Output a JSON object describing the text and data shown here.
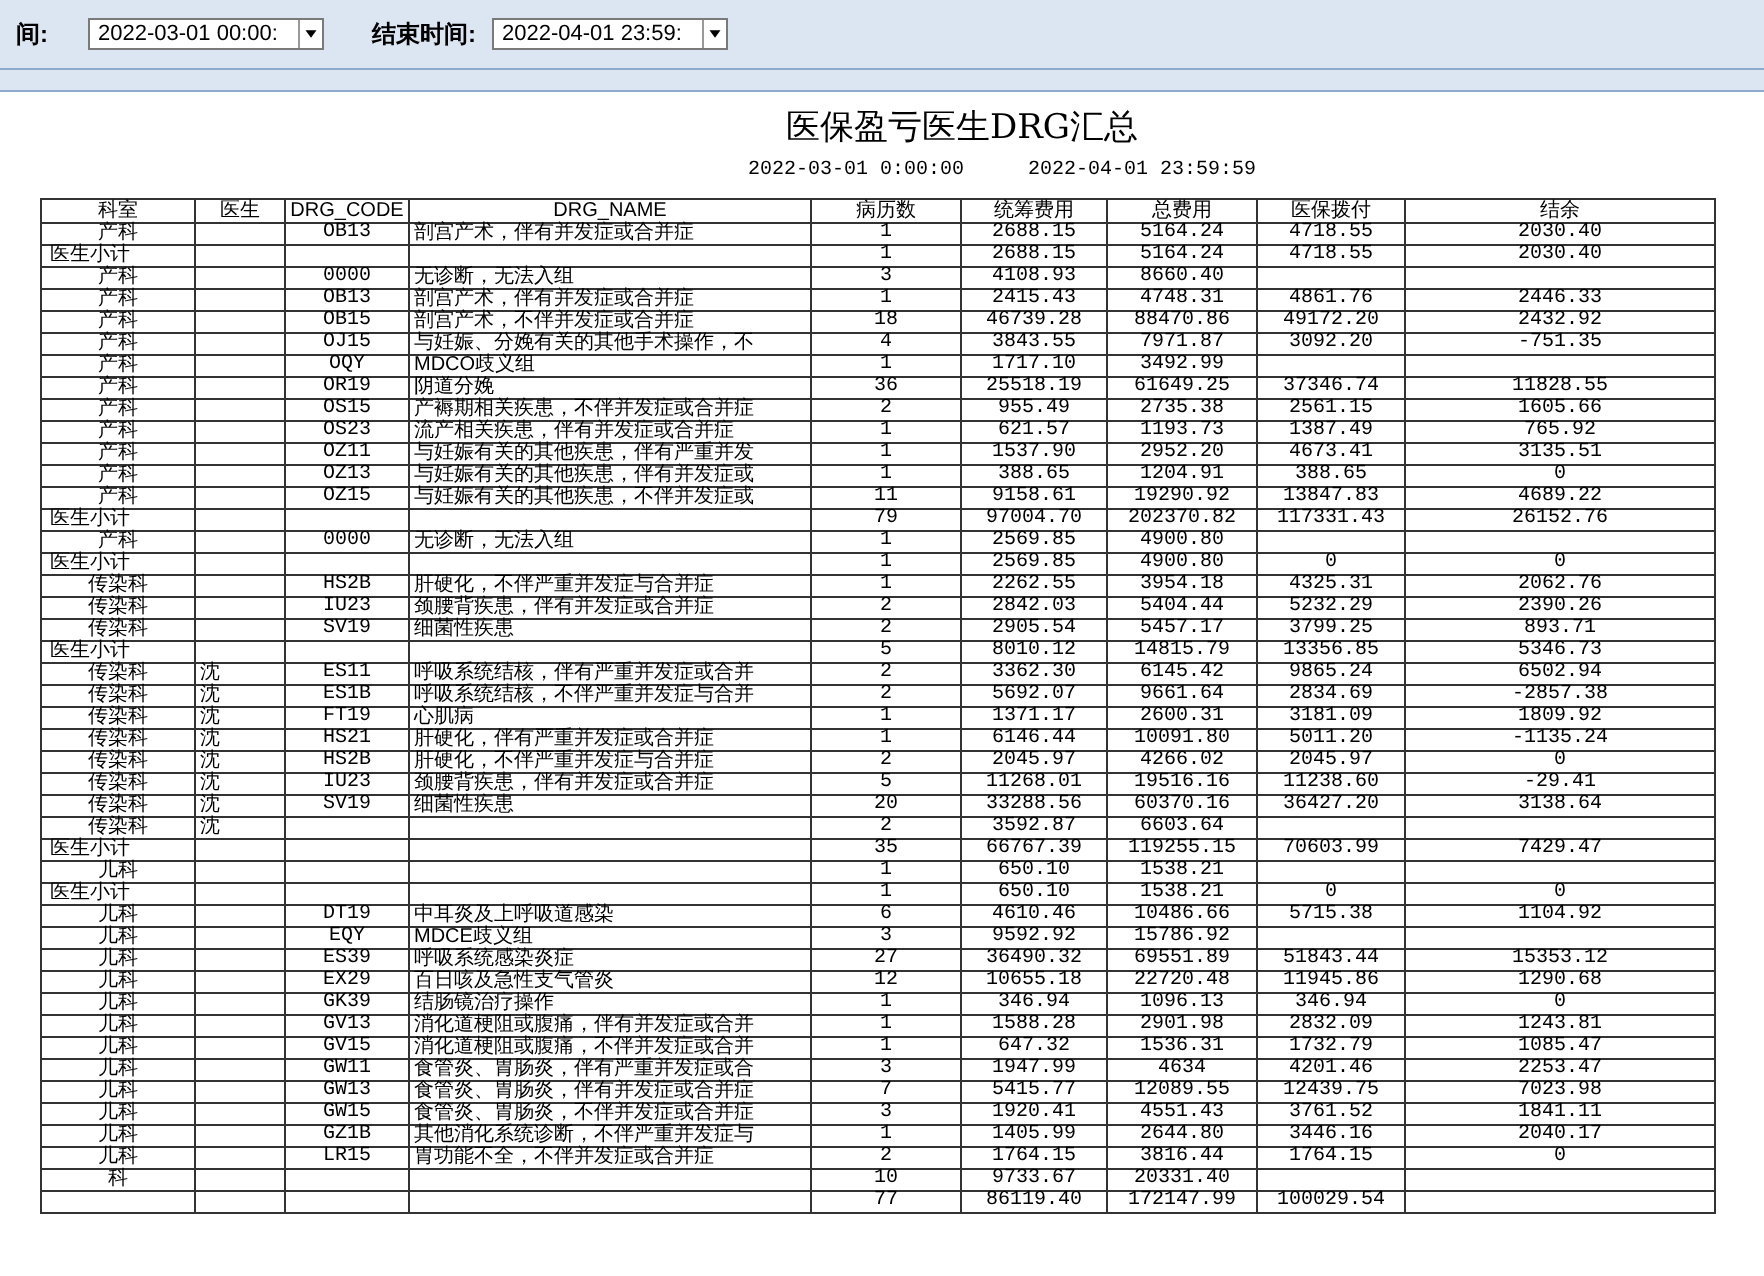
{
  "toolbar": {
    "start_label": "间:",
    "start_value": "2022-03-01 00:00:",
    "end_label": "结束时间:",
    "end_value": "2022-04-01 23:59:"
  },
  "report": {
    "title": "医保盈亏医生DRG汇总",
    "start": "2022-03-01  0:00:00",
    "end": "2022-04-01  23:59:59"
  },
  "columns": [
    "科室",
    "医生",
    "DRG_CODE",
    "DRG_NAME",
    "病历数",
    "统筹费用",
    "总费用",
    "医保拨付",
    "结余"
  ],
  "rows": [
    {
      "kind": "detail",
      "dept": "产科",
      "code": "OB13",
      "name": "剖宫产术，伴有并发症或合并症",
      "cases": "1",
      "pooled": "2688.15",
      "total": "5164.24",
      "paid": "4718.55",
      "balance": "2030.40"
    },
    {
      "kind": "subtotal",
      "dept": "医生小计",
      "cases": "1",
      "pooled": "2688.15",
      "total": "5164.24",
      "paid": "4718.55",
      "balance": "2030.40"
    },
    {
      "kind": "detail",
      "dept": "产科",
      "code": "0000",
      "name": "无诊断，无法入组",
      "cases": "3",
      "pooled": "4108.93",
      "total": "8660.40"
    },
    {
      "kind": "detail",
      "dept": "产科",
      "code": "OB13",
      "name": "剖宫产术，伴有并发症或合并症",
      "cases": "1",
      "pooled": "2415.43",
      "total": "4748.31",
      "paid": "4861.76",
      "balance": "2446.33"
    },
    {
      "kind": "detail",
      "dept": "产科",
      "code": "OB15",
      "name": "剖宫产术，不伴并发症或合并症",
      "cases": "18",
      "pooled": "46739.28",
      "total": "88470.86",
      "paid": "49172.20",
      "balance": "2432.92"
    },
    {
      "kind": "detail",
      "dept": "产科",
      "code": "OJ15",
      "name": "与妊娠、分娩有关的其他手术操作，不",
      "cases": "4",
      "pooled": "3843.55",
      "total": "7971.87",
      "paid": "3092.20",
      "balance": "-751.35"
    },
    {
      "kind": "detail",
      "dept": "产科",
      "code": "OQY",
      "name": "MDCO歧义组",
      "cases": "1",
      "pooled": "1717.10",
      "total": "3492.99"
    },
    {
      "kind": "detail",
      "dept": "产科",
      "code": "OR19",
      "name": "阴道分娩",
      "cases": "36",
      "pooled": "25518.19",
      "total": "61649.25",
      "paid": "37346.74",
      "balance": "11828.55"
    },
    {
      "kind": "detail",
      "dept": "产科",
      "code": "OS15",
      "name": "产褥期相关疾患，不伴并发症或合并症",
      "cases": "2",
      "pooled": "955.49",
      "total": "2735.38",
      "paid": "2561.15",
      "balance": "1605.66"
    },
    {
      "kind": "detail",
      "dept": "产科",
      "code": "OS23",
      "name": "流产相关疾患，伴有并发症或合并症",
      "cases": "1",
      "pooled": "621.57",
      "total": "1193.73",
      "paid": "1387.49",
      "balance": "765.92"
    },
    {
      "kind": "detail",
      "dept": "产科",
      "code": "OZ11",
      "name": "与妊娠有关的其他疾患，伴有严重并发",
      "cases": "1",
      "pooled": "1537.90",
      "total": "2952.20",
      "paid": "4673.41",
      "balance": "3135.51"
    },
    {
      "kind": "detail",
      "dept": "产科",
      "code": "OZ13",
      "name": "与妊娠有关的其他疾患，伴有并发症或",
      "cases": "1",
      "pooled": "388.65",
      "total": "1204.91",
      "paid": "388.65",
      "balance": "0"
    },
    {
      "kind": "detail",
      "dept": "产科",
      "code": "OZ15",
      "name": "与妊娠有关的其他疾患，不伴并发症或",
      "cases": "11",
      "pooled": "9158.61",
      "total": "19290.92",
      "paid": "13847.83",
      "balance": "4689.22"
    },
    {
      "kind": "subtotal",
      "dept": "医生小计",
      "cases": "79",
      "pooled": "97004.70",
      "total": "202370.82",
      "paid": "117331.43",
      "balance": "26152.76"
    },
    {
      "kind": "detail",
      "dept": "产科",
      "code": "0000",
      "name": "无诊断，无法入组",
      "cases": "1",
      "pooled": "2569.85",
      "total": "4900.80"
    },
    {
      "kind": "subtotal",
      "dept": "医生小计",
      "cases": "1",
      "pooled": "2569.85",
      "total": "4900.80",
      "paid": "0",
      "balance": "0"
    },
    {
      "kind": "detail",
      "dept": "传染科",
      "code": "HS2B",
      "name": "肝硬化，不伴严重并发症与合并症",
      "cases": "1",
      "pooled": "2262.55",
      "total": "3954.18",
      "paid": "4325.31",
      "balance": "2062.76"
    },
    {
      "kind": "detail",
      "dept": "传染科",
      "code": "IU23",
      "name": "颈腰背疾患，伴有并发症或合并症",
      "cases": "2",
      "pooled": "2842.03",
      "total": "5404.44",
      "paid": "5232.29",
      "balance": "2390.26"
    },
    {
      "kind": "detail",
      "dept": "传染科",
      "code": "SV19",
      "name": "细菌性疾患",
      "cases": "2",
      "pooled": "2905.54",
      "total": "5457.17",
      "paid": "3799.25",
      "balance": "893.71"
    },
    {
      "kind": "subtotal",
      "dept": "医生小计",
      "cases": "5",
      "pooled": "8010.12",
      "total": "14815.79",
      "paid": "13356.85",
      "balance": "5346.73"
    },
    {
      "kind": "detail",
      "dept": "传染科",
      "doctor": "沈",
      "code": "ES11",
      "name": "呼吸系统结核，伴有严重并发症或合并",
      "cases": "2",
      "pooled": "3362.30",
      "total": "6145.42",
      "paid": "9865.24",
      "balance": "6502.94"
    },
    {
      "kind": "detail",
      "dept": "传染科",
      "doctor": "沈",
      "code": "ES1B",
      "name": "呼吸系统结核，不伴严重并发症与合并",
      "cases": "2",
      "pooled": "5692.07",
      "total": "9661.64",
      "paid": "2834.69",
      "balance": "-2857.38"
    },
    {
      "kind": "detail",
      "dept": "传染科",
      "doctor": "沈",
      "code": "FT19",
      "name": "心肌病",
      "cases": "1",
      "pooled": "1371.17",
      "total": "2600.31",
      "paid": "3181.09",
      "balance": "1809.92"
    },
    {
      "kind": "detail",
      "dept": "传染科",
      "doctor": "沈",
      "code": "HS21",
      "name": "肝硬化，伴有严重并发症或合并症",
      "cases": "1",
      "pooled": "6146.44",
      "total": "10091.80",
      "paid": "5011.20",
      "balance": "-1135.24"
    },
    {
      "kind": "detail",
      "dept": "传染科",
      "doctor": "沈",
      "code": "HS2B",
      "name": "肝硬化，不伴严重并发症与合并症",
      "cases": "2",
      "pooled": "2045.97",
      "total": "4266.02",
      "paid": "2045.97",
      "balance": "0"
    },
    {
      "kind": "detail",
      "dept": "传染科",
      "doctor": "沈",
      "code": "IU23",
      "name": "颈腰背疾患，伴有并发症或合并症",
      "cases": "5",
      "pooled": "11268.01",
      "total": "19516.16",
      "paid": "11238.60",
      "balance": "-29.41"
    },
    {
      "kind": "detail",
      "dept": "传染科",
      "doctor": "沈",
      "code": "SV19",
      "name": "细菌性疾患",
      "cases": "20",
      "pooled": "33288.56",
      "total": "60370.16",
      "paid": "36427.20",
      "balance": "3138.64"
    },
    {
      "kind": "detail",
      "dept": "传染科",
      "doctor": "沈",
      "cases": "2",
      "pooled": "3592.87",
      "total": "6603.64"
    },
    {
      "kind": "subtotal",
      "dept": "医生小计",
      "cases": "35",
      "pooled": "66767.39",
      "total": "119255.15",
      "paid": "70603.99",
      "balance": "7429.47"
    },
    {
      "kind": "detail",
      "dept": "儿科",
      "cases": "1",
      "pooled": "650.10",
      "total": "1538.21"
    },
    {
      "kind": "subtotal",
      "dept": "医生小计",
      "cases": "1",
      "pooled": "650.10",
      "total": "1538.21",
      "paid": "0",
      "balance": "0"
    },
    {
      "kind": "detail",
      "dept": "儿科",
      "code": "DT19",
      "name": "中耳炎及上呼吸道感染",
      "cases": "6",
      "pooled": "4610.46",
      "total": "10486.66",
      "paid": "5715.38",
      "balance": "1104.92"
    },
    {
      "kind": "detail",
      "dept": "儿科",
      "code": "EQY",
      "name": "MDCE歧义组",
      "cases": "3",
      "pooled": "9592.92",
      "total": "15786.92"
    },
    {
      "kind": "detail",
      "dept": "儿科",
      "code": "ES39",
      "name": "呼吸系统感染炎症",
      "cases": "27",
      "pooled": "36490.32",
      "total": "69551.89",
      "paid": "51843.44",
      "balance": "15353.12"
    },
    {
      "kind": "detail",
      "dept": "儿科",
      "code": "EX29",
      "name": "百日咳及急性支气管炎",
      "cases": "12",
      "pooled": "10655.18",
      "total": "22720.48",
      "paid": "11945.86",
      "balance": "1290.68"
    },
    {
      "kind": "detail",
      "dept": "儿科",
      "code": "GK39",
      "name": "结肠镜治疗操作",
      "cases": "1",
      "pooled": "346.94",
      "total": "1096.13",
      "paid": "346.94",
      "balance": "0"
    },
    {
      "kind": "detail",
      "dept": "儿科",
      "code": "GV13",
      "name": "消化道梗阻或腹痛，伴有并发症或合并",
      "cases": "1",
      "pooled": "1588.28",
      "total": "2901.98",
      "paid": "2832.09",
      "balance": "1243.81"
    },
    {
      "kind": "detail",
      "dept": "儿科",
      "code": "GV15",
      "name": "消化道梗阻或腹痛，不伴并发症或合并",
      "cases": "1",
      "pooled": "647.32",
      "total": "1536.31",
      "paid": "1732.79",
      "balance": "1085.47"
    },
    {
      "kind": "detail",
      "dept": "儿科",
      "code": "GW11",
      "name": "食管炎、胃肠炎，伴有严重并发症或合",
      "cases": "3",
      "pooled": "1947.99",
      "total": "4634",
      "paid": "4201.46",
      "balance": "2253.47"
    },
    {
      "kind": "detail",
      "dept": "儿科",
      "code": "GW13",
      "name": "食管炎、胃肠炎，伴有并发症或合并症",
      "cases": "7",
      "pooled": "5415.77",
      "total": "12089.55",
      "paid": "12439.75",
      "balance": "7023.98"
    },
    {
      "kind": "detail",
      "dept": "儿科",
      "code": "GW15",
      "name": "食管炎、胃肠炎，不伴并发症或合并症",
      "cases": "3",
      "pooled": "1920.41",
      "total": "4551.43",
      "paid": "3761.52",
      "balance": "1841.11"
    },
    {
      "kind": "detail",
      "dept": "儿科",
      "code": "GZ1B",
      "name": "其他消化系统诊断，不伴严重并发症与",
      "cases": "1",
      "pooled": "1405.99",
      "total": "2644.80",
      "paid": "3446.16",
      "balance": "2040.17"
    },
    {
      "kind": "detail",
      "dept": "儿科",
      "code": "LR15",
      "name": "胃功能不全，不伴并发症或合并症",
      "cases": "2",
      "pooled": "1764.15",
      "total": "3816.44",
      "paid": "1764.15",
      "balance": "0"
    },
    {
      "kind": "detail",
      "dept": "科",
      "cases": "10",
      "pooled": "9733.67",
      "total": "20331.40"
    },
    {
      "kind": "subtotal",
      "cases": "77",
      "pooled": "86119.40",
      "total": "172147.99",
      "paid": "100029.54"
    }
  ]
}
